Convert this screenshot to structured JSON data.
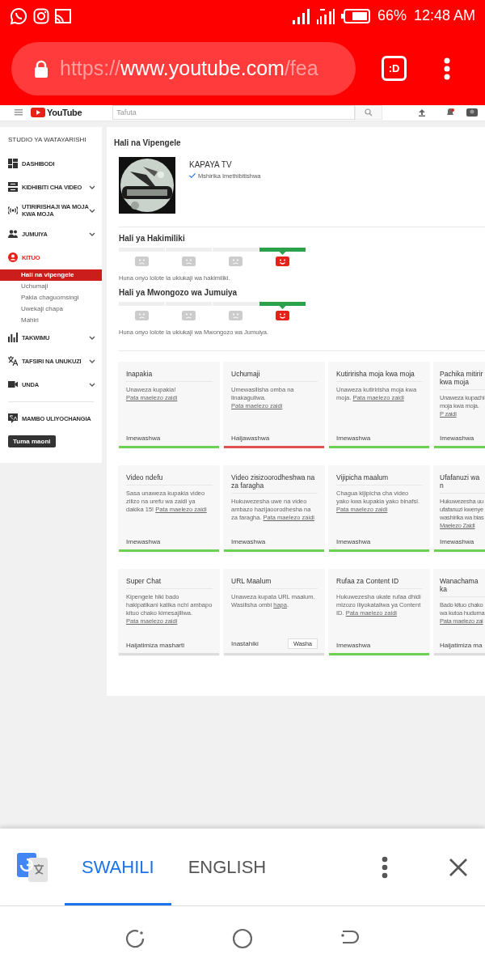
{
  "status_bar": {
    "battery": "66%",
    "time": "12:48 AM"
  },
  "browser": {
    "url_scheme": "https://",
    "url_host": "www.youtube.com",
    "url_path": "/fea",
    "tab_button": ":D"
  },
  "yt_header": {
    "logo_text": "YouTube",
    "search": {
      "placeholder": "Tafuta"
    }
  },
  "sidebar": {
    "title": "STUDIO YA WATAYARISHI",
    "items": [
      {
        "label": "DASHIBODI",
        "chevron": false,
        "expanded": false
      },
      {
        "label": "KIDHIBITI CHA VIDEO",
        "chevron": true,
        "expanded": false
      },
      {
        "label": "UTIRIRISHAJI WA MOJA KWA MOJA",
        "chevron": true,
        "expanded": false
      },
      {
        "label": "JUMUIYA",
        "chevron": true,
        "expanded": false
      },
      {
        "label": "KITUO",
        "chevron": false,
        "expanded": true,
        "children": [
          {
            "label": "Hali na vipengele",
            "selected": true
          },
          {
            "label": "Uchumaji",
            "selected": false
          },
          {
            "label": "Pakia chaguomsingi",
            "selected": false
          },
          {
            "label": "Uwekaji chapa",
            "selected": false
          },
          {
            "label": "Mahiri",
            "selected": false
          }
        ]
      },
      {
        "label": "TAKWIMU",
        "chevron": true,
        "expanded": false
      },
      {
        "label": "TAFSIRI NA UNUKUZI",
        "chevron": true,
        "expanded": false
      },
      {
        "label": "UNDA",
        "chevron": true,
        "expanded": false
      }
    ],
    "contributions": "MAMBO ULIYOCHANGIA",
    "feedback_button": "Tuma maoni"
  },
  "main": {
    "title": "Hali na Vipengele",
    "channel": {
      "name": "KAPAYA TV",
      "verified": "Mshirika Imethibitishwa"
    },
    "statuses": [
      {
        "title": "Hali ya Hakimiliki",
        "levels": [
          {
            "selected": false
          },
          {
            "selected": false
          },
          {
            "selected": false
          },
          {
            "selected": true
          }
        ],
        "message": "Huna onyo lolote la ukiukaji wa hakimiliki."
      },
      {
        "title": "Hali ya Mwongozo wa Jumuiya",
        "levels": [
          {
            "selected": false
          },
          {
            "selected": false
          },
          {
            "selected": false
          },
          {
            "selected": true
          }
        ],
        "message": "Huna onyo lolote la ukiukaji wa Mwongozo wa Jumuiya."
      }
    ],
    "cards": [
      {
        "title": "Inapakia",
        "desc": "Unaweza kupakia!",
        "link": "Pata maelezo zaidi",
        "status": "Imewashwa",
        "color": "#6cd055"
      },
      {
        "title": "Uchumaji",
        "desc": "Umewasilisha omba na linakaguliwa.",
        "link": "Pata maelezo zaidi",
        "status": "Haijawashwa",
        "color": "#e05252"
      },
      {
        "title": "Kutiririsha moja kwa moja",
        "desc": "Unaweza kutiririsha moja kwa moja.",
        "link": "Pata maelezo zaidi",
        "status": "Imewashwa",
        "color": "#6cd055"
      },
      {
        "title": "Pachika mitirir kwa moja",
        "desc": "Unaweza kupachi moja kwa moja.",
        "link": "P zaidi",
        "status": "Imewashwa",
        "color": "#6cd055"
      },
      {
        "title": "Video ndefu",
        "desc": "Sasa unaweza kupakia video zilizo na urefu wa zaidi ya dakika 15!",
        "link": "Pata maelezo zaidi",
        "status": "Imewashwa",
        "color": "#6cd055"
      },
      {
        "title": "Video zisizoorodheshwa na za faragha",
        "desc": "Hukuwezesha uwe na video ambazo hazijaoorodhesha na za faragha.",
        "link": "Pata maelezo zaidi",
        "status": "Imewashwa",
        "color": "#6cd055"
      },
      {
        "title": "Vijipicha maalum",
        "desc": "Chagua kijipicha cha video yako kwa kupakia yako binafsi.",
        "link": "Pata maelezo zaidi",
        "status": "Imewashwa",
        "color": "#6cd055"
      },
      {
        "title": "Ufafanuzi wa n",
        "desc": "Hukuwezesha uu ufafanuzi kwenye washirika wa bias",
        "link": "Maelezo Zaidi",
        "status": "Imewashwa",
        "color": "#6cd055"
      },
      {
        "title": "Super Chat",
        "desc": "Kipengele hiki bado hakipatikani katika nchi ambapo kituo chako kimesajiliwa.",
        "link": "Pata maelezo zaidi",
        "status": "Haijatimiza masharti",
        "color": "#dddddd"
      },
      {
        "title": "URL Maalum",
        "desc": "Unaweza kupata URL maalum. Wasilisha ombi",
        "link": "hapa",
        "desc_end": ".",
        "status": "Inastahiki",
        "button": "Washa",
        "color": "#dddddd"
      },
      {
        "title": "Rufaa za Content ID",
        "desc": "Hukuwezesha ukate rufaa dhidi mizozo iliyokataliwa ya Content ID.",
        "link": "Pata maelezo zaidi",
        "status": "Imewashwa",
        "color": "#6cd055"
      },
      {
        "title": "Wanachama ka",
        "desc": "Bado kituo chako wa kutoa huduma",
        "link": "Pata maelezo zai",
        "status": "Haijatimiza ma",
        "color": "#dddddd"
      }
    ]
  },
  "translate_bar": {
    "languages": [
      {
        "label": "SWAHILI",
        "selected": true
      },
      {
        "label": "ENGLISH",
        "selected": false
      }
    ]
  }
}
